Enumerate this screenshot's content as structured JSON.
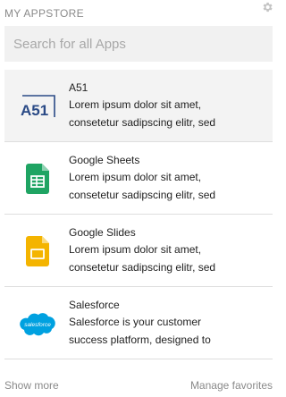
{
  "header": {
    "title": "MY APPSTORE",
    "settings_icon": "gear-icon"
  },
  "search": {
    "placeholder": "Search for all Apps",
    "value": ""
  },
  "apps": [
    {
      "name": "A51",
      "desc1": "Lorem ipsum dolor sit amet,",
      "desc2": "consetetur sadipscing elitr, sed",
      "icon": "a51-logo-icon",
      "selected": true
    },
    {
      "name": "Google Sheets",
      "desc1": "Lorem ipsum dolor sit amet,",
      "desc2": "consetetur sadipscing elitr, sed",
      "icon": "google-sheets-icon"
    },
    {
      "name": "Google Slides",
      "desc1": "Lorem ipsum dolor sit amet,",
      "desc2": "consetetur sadipscing elitr, sed",
      "icon": "google-slides-icon"
    },
    {
      "name": "Salesforce",
      "desc1": "Salesforce is your customer",
      "desc2": "success platform, designed to",
      "icon": "salesforce-logo-icon",
      "logo_text": "salesforce"
    }
  ],
  "footer": {
    "show_more": "Show more",
    "manage_favorites": "Manage favorites"
  },
  "colors": {
    "accent_blue": "#2a4a86",
    "sheets_green": "#1fa463",
    "slides_yellow": "#f4b400",
    "salesforce_blue": "#00a1e0"
  }
}
